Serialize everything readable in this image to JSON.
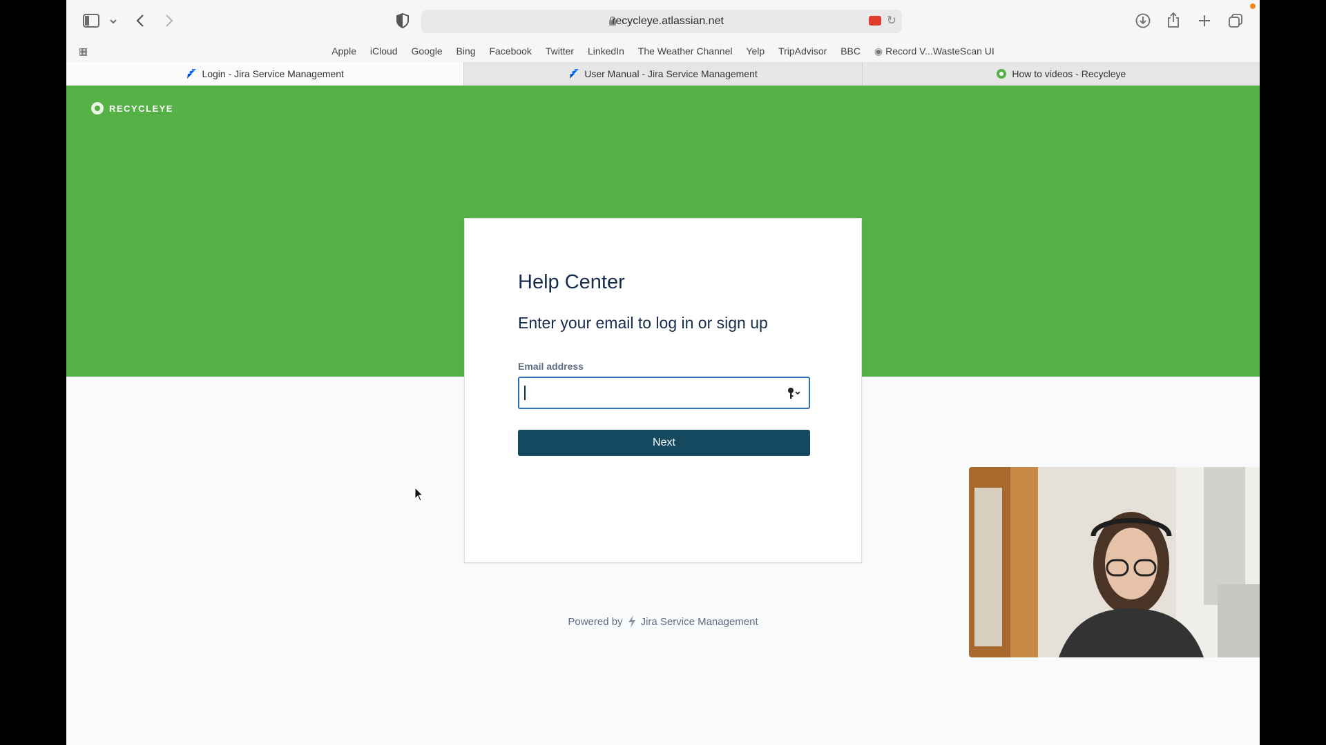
{
  "browser": {
    "url": "recycleye.atlassian.net",
    "favorites": [
      "Apple",
      "iCloud",
      "Google",
      "Bing",
      "Facebook",
      "Twitter",
      "LinkedIn",
      "The Weather Channel",
      "Yelp",
      "TripAdvisor",
      "BBC",
      "Record V...WasteScan UI"
    ],
    "tabs": [
      {
        "label": "Login - Jira Service Management",
        "active": true
      },
      {
        "label": "User Manual - Jira Service Management",
        "active": false
      },
      {
        "label": "How to videos - Recycleye",
        "active": false
      }
    ]
  },
  "page": {
    "logo_text": "RECYCLEYE",
    "card": {
      "title": "Help Center",
      "subtitle": "Enter your email to log in or sign up",
      "email_label": "Email address",
      "email_value": "",
      "next_label": "Next"
    },
    "powered_by": "Powered by",
    "powered_product": "Jira Service Management"
  },
  "colors": {
    "brand_green": "#55b045",
    "button": "#14495f",
    "focus_border": "#2f6fb0",
    "text_dark": "#172b4d"
  },
  "icons": [
    "sidebar-icon",
    "chevron-down-icon",
    "back-icon",
    "forward-icon",
    "shield-icon",
    "lock-icon",
    "screen-record-icon",
    "reload-icon",
    "download-icon",
    "share-icon",
    "new-tab-icon",
    "tab-overview-icon",
    "grid-icon",
    "key-icon"
  ]
}
